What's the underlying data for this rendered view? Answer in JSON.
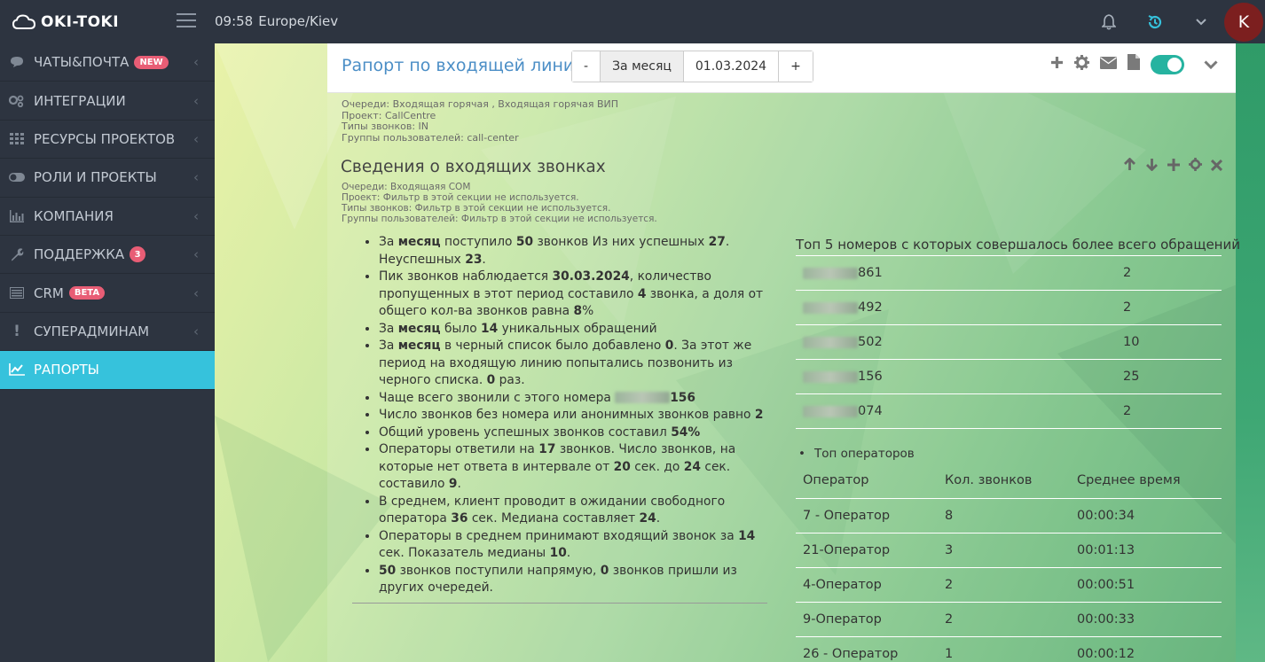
{
  "app": {
    "name": "OKI-TOKI",
    "time": "09:58",
    "timezone": "Europe/Kiev",
    "avatar_letter": "K"
  },
  "sidebar": {
    "items": [
      {
        "label": "ЧАТЫ&ПОЧТА",
        "badge": "NEW",
        "icon": "chat-icon"
      },
      {
        "label": "ИНТЕГРАЦИИ",
        "icon": "gears-icon"
      },
      {
        "label": "РЕСУРСЫ ПРОЕКТОВ",
        "icon": "grid-icon"
      },
      {
        "label": "РОЛИ И ПРОЕКТЫ",
        "icon": "toggle-icon"
      },
      {
        "label": "КОМПАНИЯ",
        "icon": "bar-chart-icon"
      },
      {
        "label": "ПОДДЕРЖКА",
        "badge": "3",
        "icon": "wrench-icon"
      },
      {
        "label": "CRM",
        "badge": "BETA",
        "icon": "list-icon"
      },
      {
        "label": "СУПЕРАДМИНАМ",
        "icon": "exclamation-icon"
      },
      {
        "label": "РАПОРТЫ",
        "icon": "line-chart-icon",
        "active": true
      }
    ]
  },
  "report": {
    "title": "Рапорт по входящей линии",
    "period": {
      "minus": "-",
      "label": "За месяц",
      "date": "01.03.2024",
      "plus": "+"
    },
    "meta": [
      "Очереди: Входящая горячая , Входящая горячая ВИП",
      "Проект: CallCentre",
      "Типы звонков: IN",
      "Группы пользователей: call-center"
    ]
  },
  "section": {
    "title": "Сведения о входящих звонках",
    "meta": [
      "Очереди: Входящаяя COM",
      "Проект: Фильтр в этой секции не используется.",
      "Типы звонков: Фильтр в этой секции не используется.",
      "Группы пользователей: Фильтр в этой секции не используется."
    ]
  },
  "top5": {
    "title": "Топ 5 номеров с которых совершалось более всего обращений",
    "rows": [
      {
        "suffix": "861",
        "count": "2"
      },
      {
        "suffix": "492",
        "count": "2"
      },
      {
        "suffix": "502",
        "count": "10"
      },
      {
        "suffix": "156",
        "count": "25"
      },
      {
        "suffix": "074",
        "count": "2"
      }
    ]
  },
  "operators": {
    "label": "Топ операторов",
    "headers": [
      "Оператор",
      "Кол. звонков",
      "Среднее время"
    ],
    "rows": [
      [
        "7 - Оператор",
        "8",
        "00:00:34"
      ],
      [
        "21-Оператор",
        "3",
        "00:01:13"
      ],
      [
        "4-Оператор",
        "2",
        "00:00:51"
      ],
      [
        "9-Оператор",
        "2",
        "00:00:33"
      ],
      [
        "26 - Оператор",
        "1",
        "00:00:12"
      ]
    ]
  },
  "facts": {
    "f1": [
      "За ",
      "месяц",
      " поступило ",
      "50",
      " звонков Из них успешных ",
      "27",
      ". Неуспешных ",
      "23",
      "."
    ],
    "f2": [
      "Пик звонков наблюдается ",
      "30.03.2024",
      ", количество пропущенных в этот период составило ",
      "4",
      " звонка, а доля от общего кол-ва звонков равна ",
      "8",
      "%"
    ],
    "f3": [
      "За ",
      "месяц",
      " было ",
      "14",
      " уникальных обращений"
    ],
    "f4": [
      "За ",
      "месяц",
      " в черный список было добавлено ",
      "0",
      ". За этот же период на входящую линию попытались позвонить из черного списка. ",
      "0",
      " раз."
    ],
    "f5": [
      "Чаще всего звонили с этого номера ",
      "156"
    ],
    "f6": [
      "Число звонков без номера или анонимных звонков равно ",
      "2"
    ],
    "f7": [
      "Общий уровень успешных звонков составил ",
      "54%"
    ],
    "f8": [
      "Операторы ответили на ",
      "17",
      " звонков. Число звонков, на которые нет ответа в интервале от ",
      "20",
      " сек. до ",
      "24",
      " сек. составило ",
      "9",
      "."
    ],
    "f9": [
      "В среднем, клиент проводит в ожидании свободного оператора ",
      "36",
      " сек. Медиана составляет ",
      "24",
      "."
    ],
    "f10": [
      "Операторы в среднем принимают входящий звонок за ",
      "14",
      " сек. Показатель медианы ",
      "10",
      "."
    ],
    "f11": [
      "50",
      " звонков поступили напрямую, ",
      "0",
      " звонков пришли из других очередей."
    ]
  }
}
